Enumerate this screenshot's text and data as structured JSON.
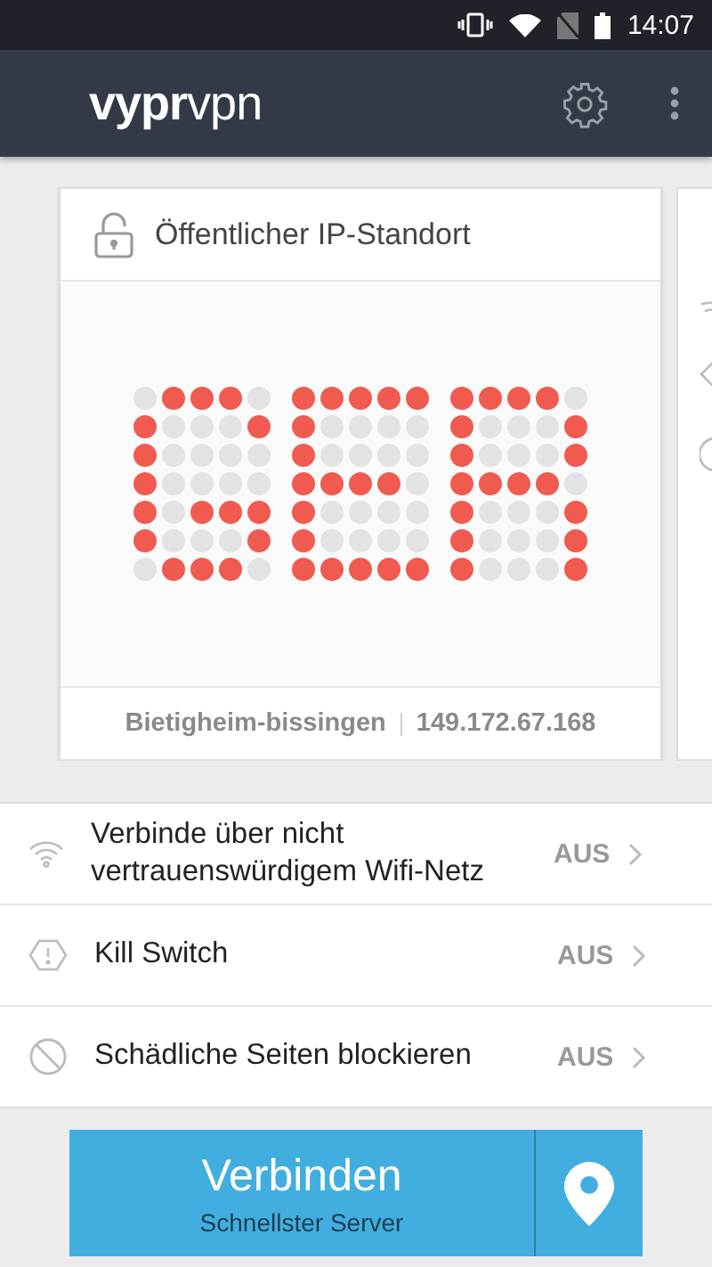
{
  "status_bar": {
    "time": "14:07"
  },
  "app_bar": {
    "logo_bold": "vypr",
    "logo_light": "vpn"
  },
  "location_card": {
    "title": "Öffentlicher IP-Standort",
    "locked": false,
    "dot_matrix": [
      [
        [
          false,
          true,
          true,
          true,
          false
        ],
        [
          true,
          false,
          false,
          false,
          true
        ],
        [
          true,
          false,
          false,
          false,
          false
        ],
        [
          true,
          false,
          false,
          false,
          false
        ],
        [
          true,
          false,
          true,
          true,
          true
        ],
        [
          true,
          false,
          false,
          false,
          true
        ],
        [
          false,
          true,
          true,
          true,
          false
        ]
      ],
      [
        [
          true,
          true,
          true,
          true,
          true
        ],
        [
          true,
          false,
          false,
          false,
          false
        ],
        [
          true,
          false,
          false,
          false,
          false
        ],
        [
          true,
          true,
          true,
          true,
          false
        ],
        [
          true,
          false,
          false,
          false,
          false
        ],
        [
          true,
          false,
          false,
          false,
          false
        ],
        [
          true,
          true,
          true,
          true,
          true
        ]
      ],
      [
        [
          true,
          true,
          true,
          true,
          false
        ],
        [
          true,
          false,
          false,
          false,
          true
        ],
        [
          true,
          false,
          false,
          false,
          true
        ],
        [
          true,
          true,
          true,
          true,
          false
        ],
        [
          true,
          false,
          false,
          false,
          true
        ],
        [
          true,
          false,
          false,
          false,
          true
        ],
        [
          true,
          false,
          false,
          false,
          true
        ]
      ]
    ],
    "city": "Bietigheim-bissingen",
    "ip": "149.172.67.168"
  },
  "settings": [
    {
      "kind": "wifi",
      "label": "Verbinde über nicht vertrauenswürdigem Wifi-Netz",
      "value": "AUS"
    },
    {
      "kind": "killswitch",
      "label": "Kill Switch",
      "value": "AUS"
    },
    {
      "kind": "block",
      "label": "Schädliche Seiten blockieren",
      "value": "AUS"
    }
  ],
  "connect_button": {
    "label": "Verbinden",
    "sublabel": "Schnellster Server"
  }
}
